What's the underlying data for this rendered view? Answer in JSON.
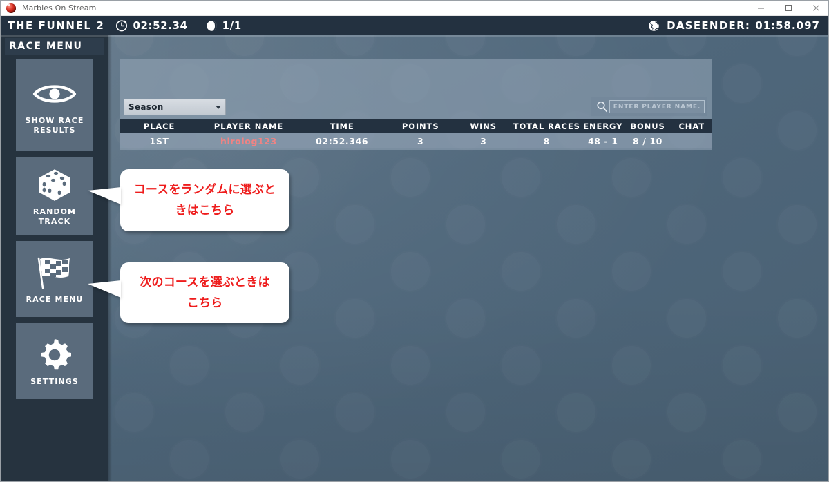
{
  "window": {
    "title": "Marbles On Stream",
    "app_icon": "marble-icon",
    "controls": {
      "minimize": "minimize-icon",
      "maximize": "maximize-icon",
      "close": "close-icon"
    }
  },
  "hud": {
    "track_name": "THE FUNNEL 2",
    "clock_icon": "clock-icon",
    "race_time": "02:52.34",
    "lap_icon": "marble-half-icon",
    "lap_counter": "1/1",
    "record_icon": "globe-icon",
    "record_holder": "DASEENDER:",
    "record_time": "01:58.097"
  },
  "sidebar": {
    "title": "RACE MENU",
    "items": [
      {
        "id": "show-race-results",
        "label": "SHOW RACE\nRESULTS",
        "label_line1": "SHOW RACE",
        "label_line2": "RESULTS",
        "icon": "eye-icon"
      },
      {
        "id": "random-track",
        "label": "RANDOM\nTRACK",
        "label_line1": "RANDOM",
        "label_line2": "TRACK",
        "icon": "dice-icon"
      },
      {
        "id": "race-menu",
        "label": "RACE MENU",
        "label_line1": "RACE MENU",
        "label_line2": "",
        "icon": "checkered-flag-icon"
      },
      {
        "id": "settings",
        "label": "SETTINGS",
        "label_line1": "SETTINGS",
        "label_line2": "",
        "icon": "gear-icon"
      }
    ]
  },
  "filters": {
    "season_select": {
      "value": "Season",
      "arrow_icon": "chevron-down-icon"
    },
    "search": {
      "icon": "search-icon",
      "value": "",
      "placeholder": "ENTER PLAYER NAME."
    }
  },
  "results": {
    "columns": [
      "PLACE",
      "PLAYER NAME",
      "TIME",
      "POINTS",
      "WINS",
      "TOTAL RACES",
      "ENERGY",
      "BONUS",
      "CHAT"
    ],
    "rows": [
      {
        "place": "1ST",
        "player_name": "hirolog123",
        "time": "02:52.346",
        "points": "3",
        "wins": "3",
        "total_races": "8",
        "energy": "48 - 1",
        "bonus": "8 / 10",
        "chat": ""
      }
    ]
  },
  "callouts": [
    {
      "id": "random-track-callout",
      "line1": "コースをランダムに選ぶと",
      "line2": "きはこちら"
    },
    {
      "id": "race-menu-callout",
      "line1": "次のコースを選ぶときは",
      "line2": "こちら"
    }
  ],
  "colors": {
    "hud_bg": "#233140",
    "sidebar_bg": "#26333f",
    "button_bg": "#5a6b7c",
    "background": "#52697d",
    "player_name": "#f08383",
    "callout_text": "#ee1c1c"
  }
}
